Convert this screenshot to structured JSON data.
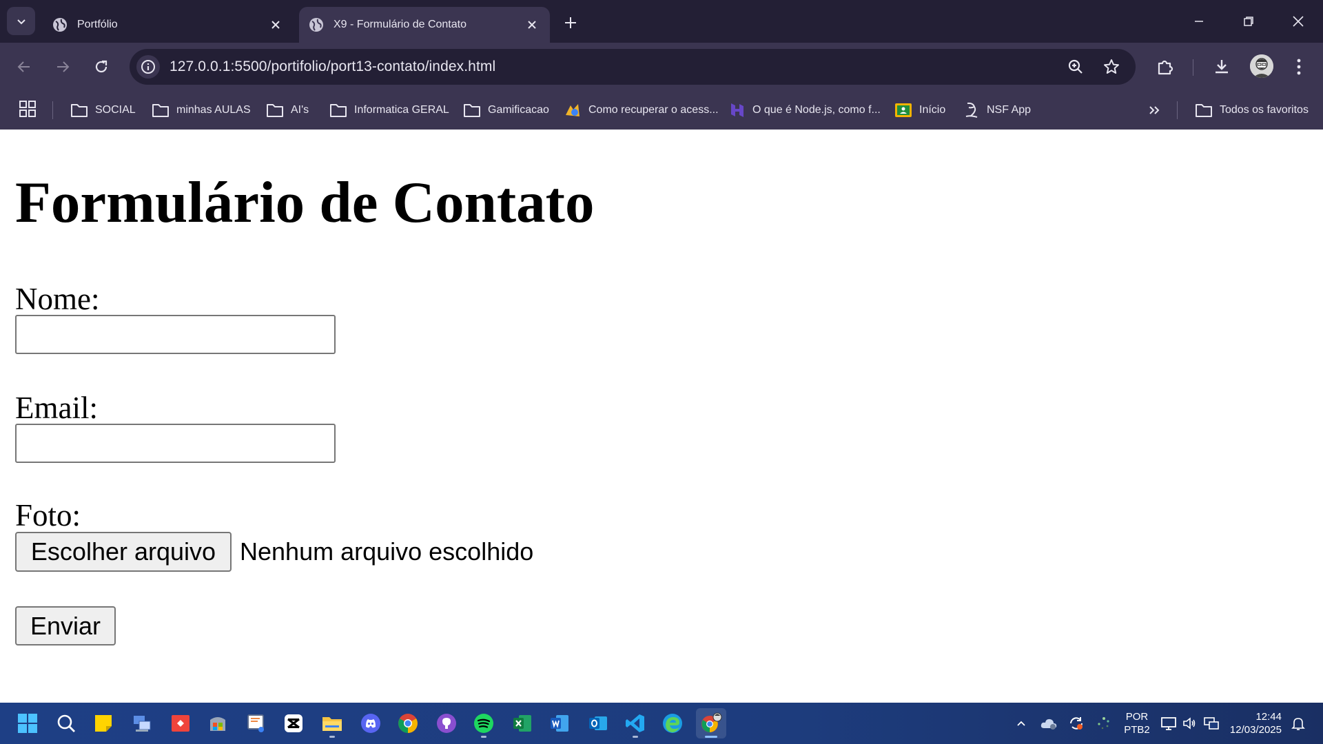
{
  "browser": {
    "tabs": [
      {
        "title": "Portfólio",
        "active": false
      },
      {
        "title": "X9 - Formulário de Contato",
        "active": true
      }
    ],
    "url": "127.0.0.1:5500/portifolio/port13-contato/index.html",
    "bookmarks": [
      {
        "label": "SOCIAL",
        "icon": "folder-icon"
      },
      {
        "label": "minhas AULAS",
        "icon": "folder-icon"
      },
      {
        "label": "AI's",
        "icon": "folder-icon"
      },
      {
        "label": "Informatica GERAL",
        "icon": "folder-icon"
      },
      {
        "label": "Gamificacao",
        "icon": "folder-icon"
      },
      {
        "label": "Como recuperar o acess...",
        "icon": "site-favicon"
      },
      {
        "label": "O que é Node.js, como f...",
        "icon": "site-favicon"
      },
      {
        "label": "Início",
        "icon": "classroom-favicon"
      },
      {
        "label": "NSF App",
        "icon": "site-favicon"
      }
    ],
    "all_bookmarks_label": "Todos os favoritos"
  },
  "page": {
    "title": "Formulário de Contato",
    "fields": {
      "name_label": "Nome:",
      "name_value": "",
      "email_label": "Email:",
      "email_value": "",
      "photo_label": "Foto:",
      "file_button": "Escolher arquivo",
      "file_status": "Nenhum arquivo escolhido"
    },
    "submit_label": "Enviar"
  },
  "taskbar": {
    "language": "POR",
    "layout": "PTB2",
    "time": "12:44",
    "date": "12/03/2025"
  },
  "colors": {
    "tabstrip": "#231f35",
    "toolbar": "#3b3551",
    "taskbar": "#1e3f85"
  }
}
